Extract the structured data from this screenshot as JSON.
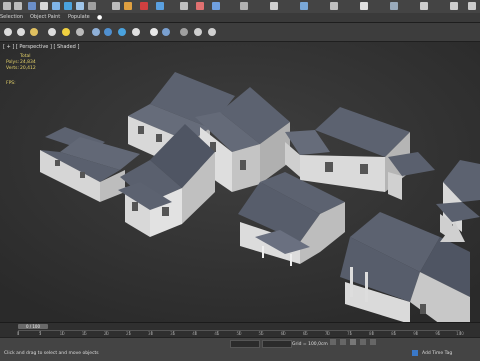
{
  "ribbon": {
    "tabs": [
      "Selection",
      "Object Paint",
      "Populate"
    ]
  },
  "viewport": {
    "label": "[ + ] [ Perspective ] [ Shaded ]",
    "stats": {
      "header": "Total",
      "polys_label": "Polys:",
      "polys": "24,834",
      "verts_label": "Verts:",
      "verts": "20,412"
    },
    "fps": "FPS:"
  },
  "timeline": {
    "frame": "0 / 100",
    "ticks": [
      "0",
      "5",
      "10",
      "15",
      "20",
      "25",
      "30",
      "35",
      "40",
      "45",
      "50",
      "55",
      "60",
      "65",
      "70",
      "75",
      "80",
      "85",
      "90",
      "95",
      "100"
    ]
  },
  "status": {
    "message": "Click and drag to select and move objects",
    "grid": "Grid = 100,0cm",
    "time_tag": "Add Time Tag"
  },
  "colors": {
    "viewport_bg": "#3a3a3a",
    "roof": "#5c6270",
    "wall": "#d9d9d9",
    "stats": "#e6d36a"
  }
}
